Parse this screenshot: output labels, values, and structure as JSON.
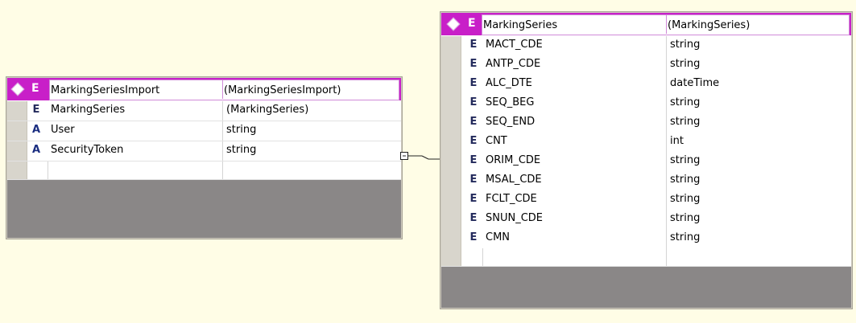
{
  "colors": {
    "background": "#fffde6",
    "header_accent": "#c81fc8",
    "panel": "#cfcbbf",
    "empty_area": "#8a8787"
  },
  "left_table": {
    "header": {
      "kind": "E",
      "name": "MarkingSeriesImport",
      "type": "(MarkingSeriesImport)"
    },
    "rows": [
      {
        "kind": "E",
        "name": "MarkingSeries",
        "type": "(MarkingSeries)"
      },
      {
        "kind": "A",
        "name": "User",
        "type": "string"
      },
      {
        "kind": "A",
        "name": "SecurityToken",
        "type": "string"
      }
    ]
  },
  "right_table": {
    "header": {
      "kind": "E",
      "name": "MarkingSeries",
      "type": "(MarkingSeries)"
    },
    "rows": [
      {
        "kind": "E",
        "name": "MACT_CDE",
        "type": "string"
      },
      {
        "kind": "E",
        "name": "ANTP_CDE",
        "type": "string"
      },
      {
        "kind": "E",
        "name": "ALC_DTE",
        "type": "dateTime"
      },
      {
        "kind": "E",
        "name": "SEQ_BEG",
        "type": "string"
      },
      {
        "kind": "E",
        "name": "SEQ_END",
        "type": "string"
      },
      {
        "kind": "E",
        "name": "CNT",
        "type": "int"
      },
      {
        "kind": "E",
        "name": "ORIM_CDE",
        "type": "string"
      },
      {
        "kind": "E",
        "name": "MSAL_CDE",
        "type": "string"
      },
      {
        "kind": "E",
        "name": "FCLT_CDE",
        "type": "string"
      },
      {
        "kind": "E",
        "name": "SNUN_CDE",
        "type": "string"
      },
      {
        "kind": "E",
        "name": "CMN",
        "type": "string"
      }
    ]
  }
}
